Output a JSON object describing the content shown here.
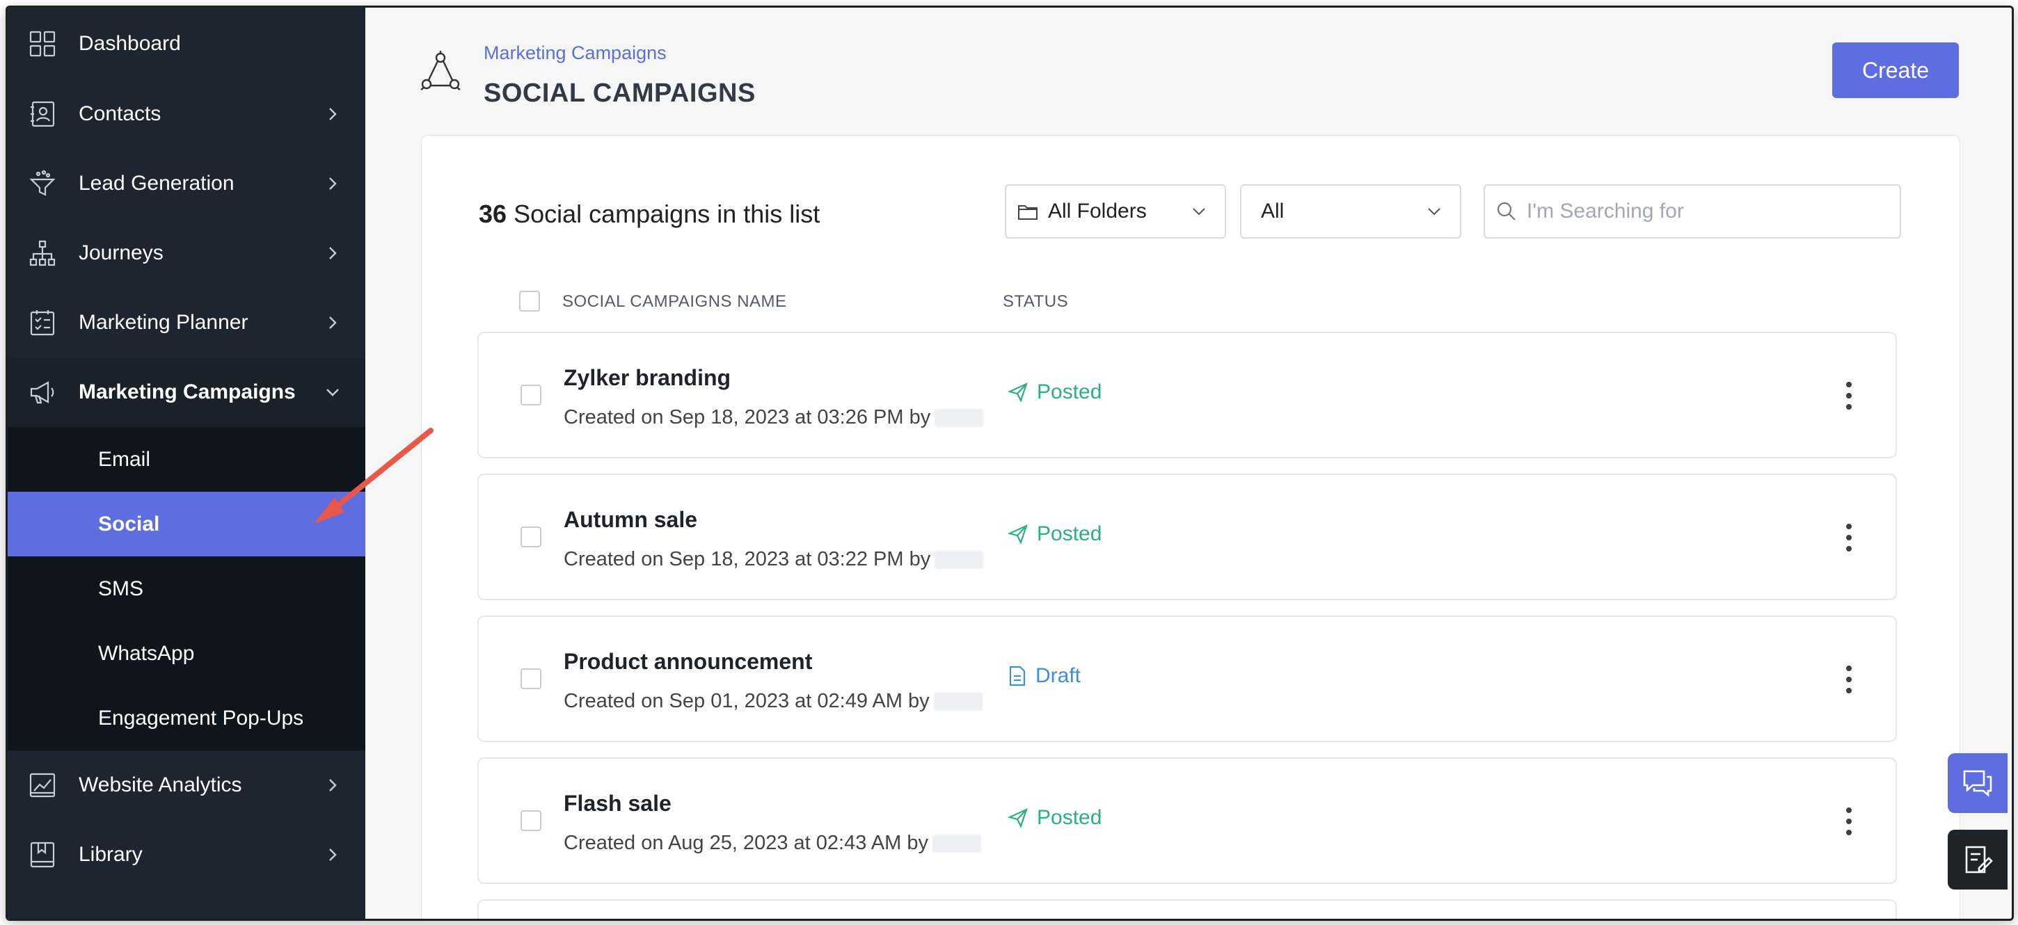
{
  "sidebar": {
    "items": [
      {
        "label": "Dashboard",
        "icon": "dashboard-icon",
        "chevron": false
      },
      {
        "label": "Contacts",
        "icon": "contacts-icon",
        "chevron": true
      },
      {
        "label": "Lead Generation",
        "icon": "funnel-icon",
        "chevron": true
      },
      {
        "label": "Journeys",
        "icon": "journey-icon",
        "chevron": true
      },
      {
        "label": "Marketing Planner",
        "icon": "planner-icon",
        "chevron": true
      },
      {
        "label": "Marketing Campaigns",
        "icon": "megaphone-icon",
        "chevron": true,
        "expanded": true
      }
    ],
    "sub_items": [
      {
        "label": "Email"
      },
      {
        "label": "Social",
        "active": true
      },
      {
        "label": "SMS"
      },
      {
        "label": "WhatsApp"
      },
      {
        "label": "Engagement Pop-Ups"
      }
    ],
    "bottom_items": [
      {
        "label": "Website Analytics",
        "icon": "analytics-icon"
      },
      {
        "label": "Library",
        "icon": "library-icon"
      }
    ]
  },
  "header": {
    "breadcrumb": "Marketing Campaigns",
    "title": "SOCIAL CAMPAIGNS",
    "create_label": "Create"
  },
  "list": {
    "count": "36",
    "count_suffix": "Social campaigns in this list",
    "folder_filter": "All Folders",
    "status_filter": "All",
    "search_placeholder": "I'm Searching for",
    "columns": {
      "name": "SOCIAL CAMPAIGNS NAME",
      "status": "STATUS"
    },
    "rows": [
      {
        "name": "Zylker branding",
        "created": "Created on Sep 18, 2023 at 03:26 PM by",
        "status": "Posted"
      },
      {
        "name": "Autumn sale",
        "created": "Created on Sep 18, 2023 at 03:22 PM by",
        "status": "Posted"
      },
      {
        "name": "Product announcement",
        "created": "Created on Sep 01, 2023 at 02:49 AM by",
        "status": "Draft"
      },
      {
        "name": "Flash sale",
        "created": "Created on Aug 25, 2023 at 02:43 AM by",
        "status": "Posted"
      }
    ]
  },
  "colors": {
    "sidebar_bg": "#1c2530",
    "active_item": "#5e6ee0",
    "posted": "#2bb07f",
    "draft": "#3d8fd6",
    "annotation_arrow": "#e8584a"
  }
}
